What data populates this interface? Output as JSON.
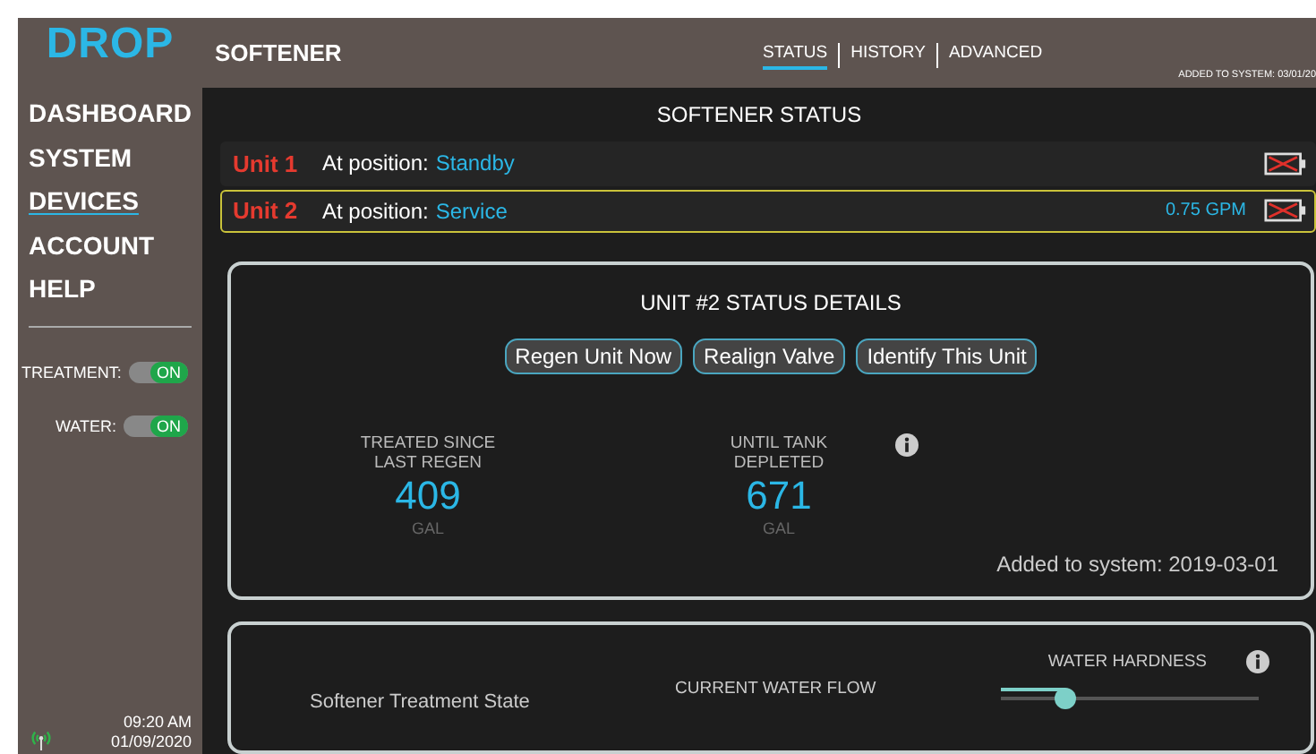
{
  "logo": "DROP",
  "sidebar": {
    "items": [
      {
        "label": "DASHBOARD",
        "selected": false
      },
      {
        "label": "SYSTEM",
        "selected": false
      },
      {
        "label": "DEVICES",
        "selected": true
      },
      {
        "label": "ACCOUNT",
        "selected": false
      },
      {
        "label": "HELP",
        "selected": false
      }
    ],
    "toggles": [
      {
        "label": "TREATMENT:",
        "state": "ON",
        "on": true
      },
      {
        "label": "WATER:",
        "state": "ON",
        "on": true
      }
    ],
    "time": "09:20 AM",
    "date": "01/09/2020"
  },
  "header": {
    "title": "SOFTENER",
    "tabs": [
      {
        "label": "STATUS",
        "selected": true
      },
      {
        "label": "HISTORY",
        "selected": false
      },
      {
        "label": "ADVANCED",
        "selected": false
      }
    ],
    "added": "ADDED TO SYSTEM: 03/01/20"
  },
  "status": {
    "title": "SOFTENER STATUS",
    "units": [
      {
        "name": "Unit 1",
        "position_label": "At position:",
        "position": "Standby",
        "selected": false
      },
      {
        "name": "Unit 2",
        "position_label": "At position:",
        "position": "Service",
        "flow": "0.75 GPM",
        "selected": true
      }
    ]
  },
  "details": {
    "title": "UNIT #2 STATUS DETAILS",
    "buttons": [
      "Regen Unit Now",
      "Realign Valve",
      "Identify This Unit"
    ],
    "stats": [
      {
        "label": "TREATED SINCE LAST REGEN",
        "value": "409",
        "unit": "GAL"
      },
      {
        "label": "UNTIL TANK DEPLETED",
        "value": "671",
        "unit": "GAL"
      }
    ],
    "added": "Added to system: 2019-03-01"
  },
  "flow_panel": {
    "state_label": "Softener Treatment State",
    "flow_label": "CURRENT WATER FLOW",
    "hardness": {
      "label": "WATER HARDNESS",
      "level": 0.25
    }
  }
}
